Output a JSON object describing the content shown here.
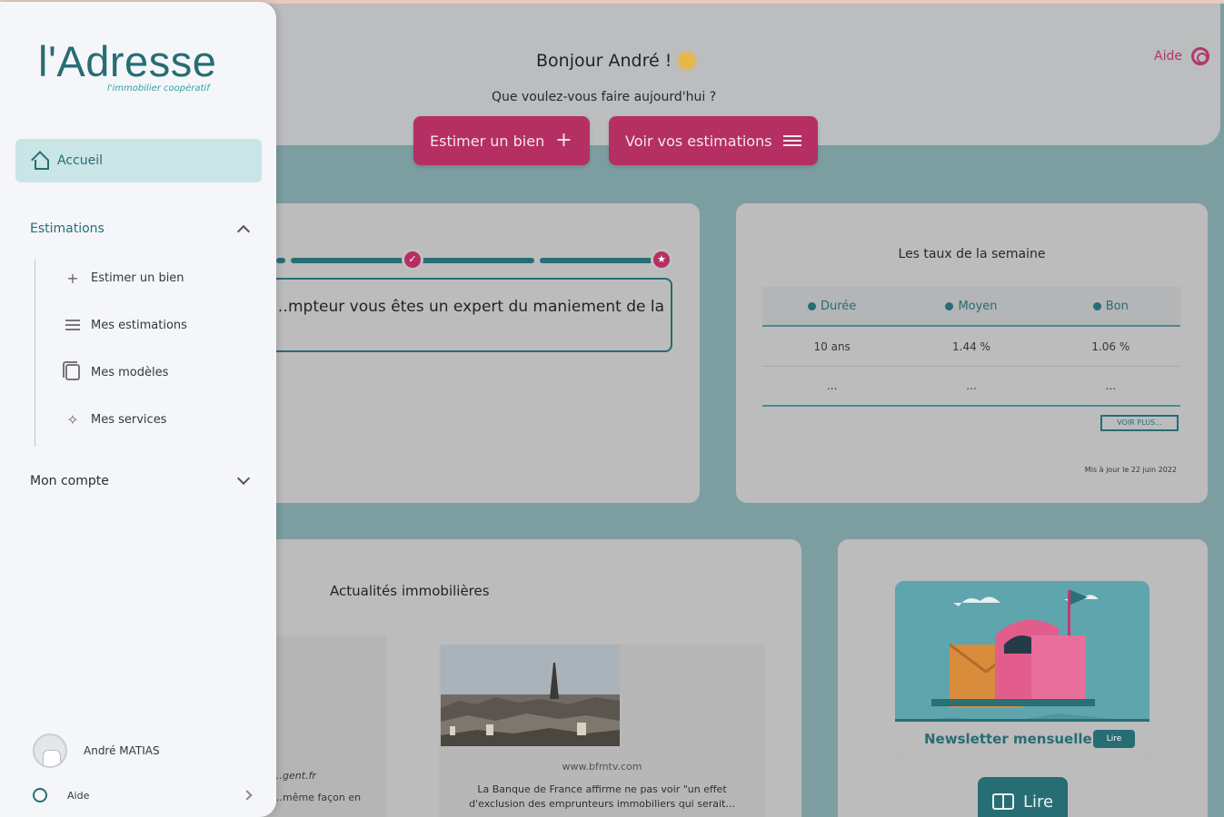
{
  "header": {
    "greeting": "Bonjour André !",
    "subtitle": "Que voulez-vous faire aujourd'hui ?",
    "help_label": "Aide",
    "btn_estimer": "Estimer un bien",
    "btn_voir": "Voir vos estimations"
  },
  "progress_card": {
    "question": "…mpteur vous êtes un expert du maniement de la",
    "step_check": "✓",
    "step_star": "★"
  },
  "rates": {
    "title": "Les taux de la semaine",
    "columns": [
      "Durée",
      "Moyen",
      "Bon"
    ],
    "rows": [
      [
        "10 ans",
        "1.44 %",
        "1.06 %"
      ],
      [
        "...",
        "...",
        "..."
      ]
    ],
    "voir_plus": "VOIR PLUS...",
    "updated": "Mis à jour le 22 juin 2022"
  },
  "news": {
    "title": "Actualités immobilières",
    "left_source": "…gent.fr",
    "left_text": "…même façon en",
    "article_source": "www.bfmtv.com",
    "article_text": "La Banque de France affirme ne pas voir \"un effet d'exclusion des emprunteurs immobiliers qui serait..."
  },
  "newsletter": {
    "logo_text": "l'Adresse",
    "label": "Newsletter mensuelle",
    "pill": "Lire",
    "button": "Lire"
  },
  "sidebar": {
    "logo": "l'Adresse",
    "logo_sub": "l'immobilier coopératif",
    "accueil": "Accueil",
    "section_estimations": "Estimations",
    "items": [
      {
        "label": "Estimer un bien"
      },
      {
        "label": "Mes estimations"
      },
      {
        "label": "Mes modèles"
      },
      {
        "label": "Mes services"
      }
    ],
    "section_compte": "Mon compte",
    "user_name": "André MATIAS",
    "help": "Aide"
  },
  "colors": {
    "pink": "#b52f63",
    "teal": "#276d74",
    "sidebar_bg": "#f4f6f9",
    "active_bg": "#c9e5e6"
  }
}
